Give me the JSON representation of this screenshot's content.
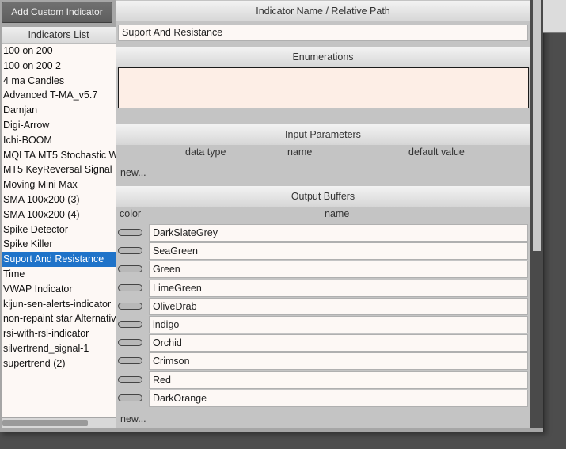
{
  "left": {
    "add_button": "Add Custom Indicator",
    "list_header": "Indicators List",
    "items": [
      "100 on 200",
      "100 on 200 2",
      "4 ma Candles",
      "Advanced T-MA_v5.7",
      "Damjan",
      "Digi-Arrow",
      "Ichi-BOOM",
      "MQLTA MT5 Stochastic W",
      "MT5 KeyReversal Signal",
      "Moving Mini Max",
      "SMA 100x200 (3)",
      "SMA 100x200 (4)",
      "Spike Detector",
      "Spike Killer",
      "Suport And Resistance",
      "Time",
      "VWAP Indicator",
      "kijun-sen-alerts-indicator",
      "non-repaint star Alternativ",
      "rsi-with-rsi-indicator",
      "silvertrend_signal-1",
      "supertrend (2)"
    ],
    "selected_index": 14
  },
  "main": {
    "name_header": "Indicator Name / Relative Path",
    "name_value": "Suport And Resistance",
    "enum_header": "Enumerations",
    "input_header": "Input Parameters",
    "input_cols": {
      "type": "data type",
      "name": "name",
      "default": "default value"
    },
    "input_new": "new...",
    "output_header": "Output Buffers",
    "output_cols": {
      "color": "color",
      "name": "name"
    },
    "buffers": [
      "DarkSlateGrey",
      "SeaGreen",
      "Green",
      "LimeGreen",
      "OliveDrab",
      "indigo",
      "Orchid",
      "Crimson",
      "Red",
      "DarkOrange"
    ],
    "output_new": "new..."
  }
}
